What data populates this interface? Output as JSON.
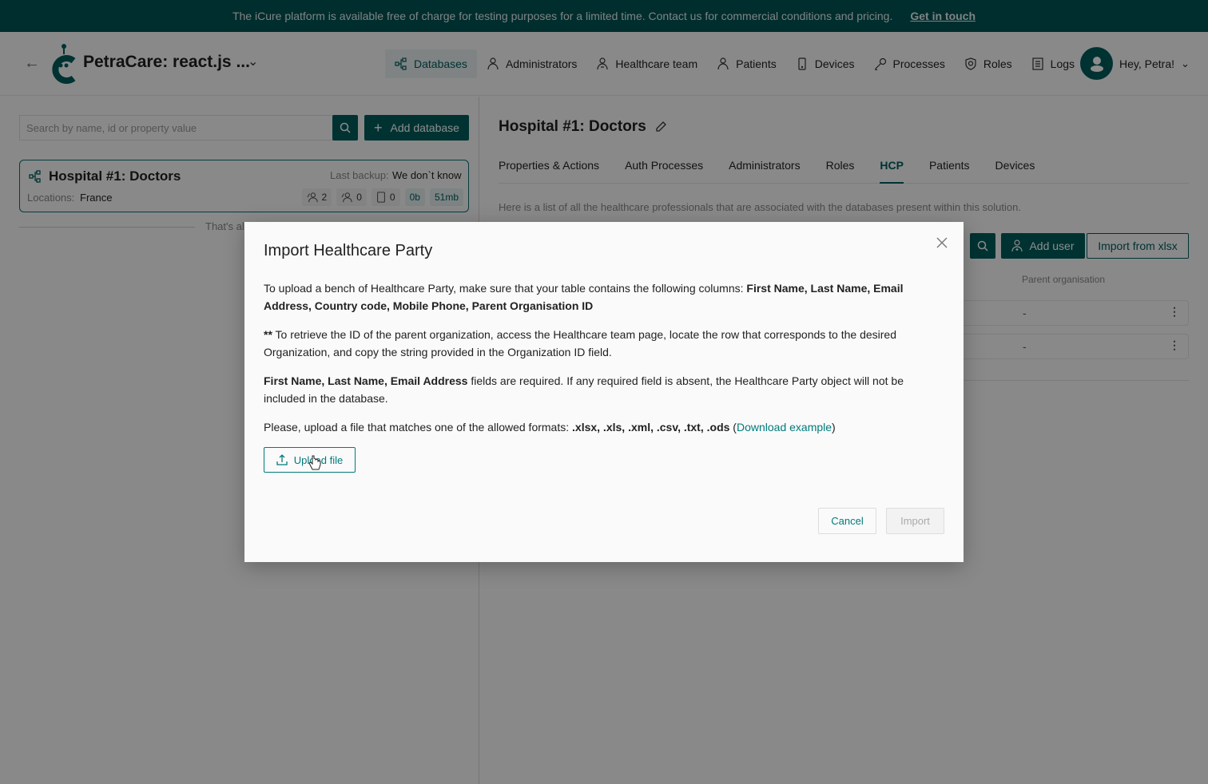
{
  "banner": {
    "message": "The iCure platform is available free of charge for testing purposes for a limited time. Contact us for commercial conditions and pricing.",
    "link": "Get in touch"
  },
  "header": {
    "app_title": "PetraCare: react.js ...",
    "nav": [
      {
        "label": "Databases",
        "icon": "databases-icon",
        "active": true
      },
      {
        "label": "Administrators",
        "icon": "administrators-icon"
      },
      {
        "label": "Healthcare team",
        "icon": "healthcare-team-icon"
      },
      {
        "label": "Patients",
        "icon": "patients-icon"
      },
      {
        "label": "Devices",
        "icon": "devices-icon"
      },
      {
        "label": "Processes",
        "icon": "key-icon"
      },
      {
        "label": "Roles",
        "icon": "shield-icon"
      },
      {
        "label": "Logs",
        "icon": "logs-icon"
      }
    ],
    "user_greeting": "Hey, Petra!"
  },
  "sidebar": {
    "search_placeholder": "Search by name, id or property value",
    "add_database": "Add database",
    "database": {
      "name": "Hospital #1: Doctors",
      "locations_label": "Locations:",
      "locations_value": "France",
      "backup_label": "Last backup:",
      "backup_value": "We don`t know",
      "stats": {
        "hcp": "2",
        "patients": "0",
        "devices": "0",
        "size_a": "0b",
        "size_b": "51mb"
      }
    },
    "end_text": "That's all"
  },
  "main": {
    "title": "Hospital #1: Doctors",
    "tabs": [
      {
        "label": "Properties & Actions"
      },
      {
        "label": "Auth Processes"
      },
      {
        "label": "Administrators"
      },
      {
        "label": "Roles"
      },
      {
        "label": "HCP",
        "active": true
      },
      {
        "label": "Patients"
      },
      {
        "label": "Devices"
      }
    ],
    "description": "Here is a list of all the healthcare professionals that are associated with the databases present within this solution.",
    "add_user": "Add user",
    "import_xlsx": "Import from xlsx",
    "table": {
      "visible_column": "Parent organisation",
      "rows": [
        {
          "parent_organisation": "-"
        },
        {
          "parent_organisation": "-"
        }
      ]
    }
  },
  "modal": {
    "title": "Import Healthcare Party",
    "p1_text": "To upload a bench of Healthcare Party, make sure that your table contains the following columns: ",
    "p1_bold": "First Name, Last Name, Email Address, Country code, Mobile Phone, Parent Organisation ID",
    "p2_bold": "**",
    "p2_text": " To retrieve the ID of the parent organization, access the Healthcare team page, locate the row that corresponds to the desired Organization, and copy the string provided in the Organization ID field.",
    "p3_bold": "First Name, Last Name, Email Address",
    "p3_text": " fields are required. If any required field is absent, the Healthcare Party object will not be included in the database.",
    "p4_text": "Please, upload a file that matches one of the allowed formats: ",
    "p4_formats": ".xlsx, .xls, .xml, .csv, .txt, .ods",
    "p4_open": " (",
    "p4_link": "Download example",
    "p4_close": ")",
    "upload_label": "Upload file",
    "cancel_label": "Cancel",
    "import_label": "Import"
  }
}
